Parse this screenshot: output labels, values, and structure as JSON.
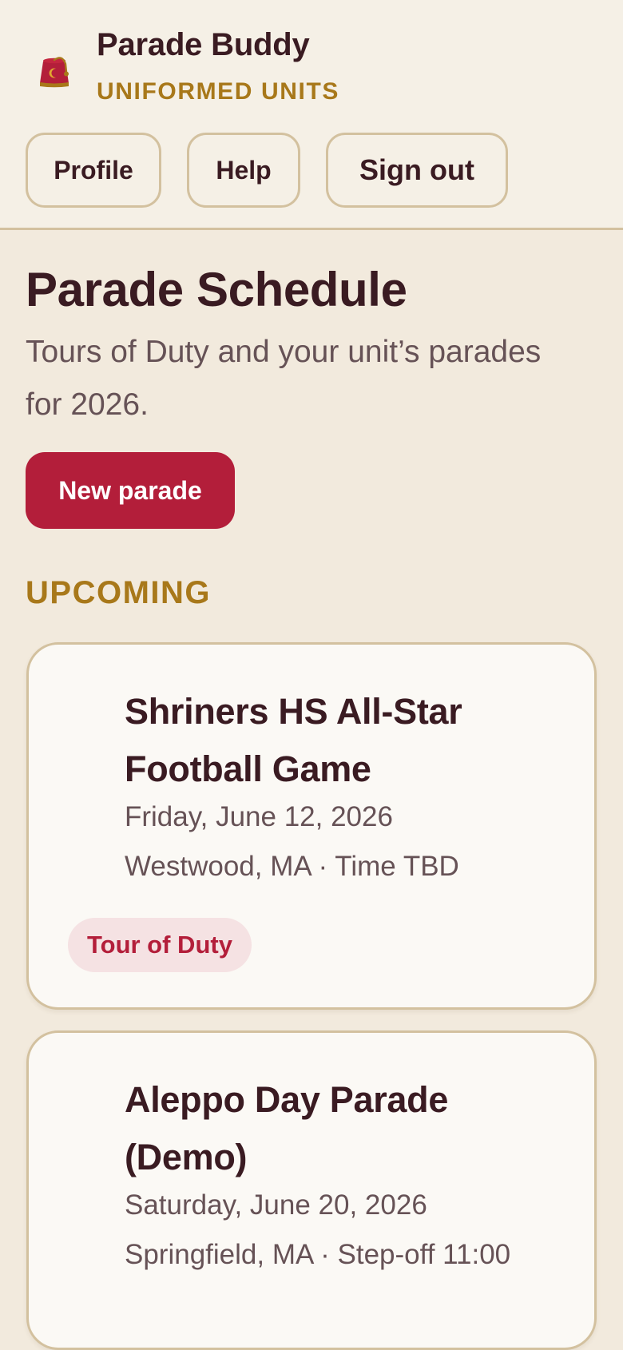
{
  "app": {
    "name": "Parade Buddy",
    "subtitle": "UNIFORMED UNITS",
    "logo_icon": "fez-icon"
  },
  "nav": {
    "profile": "Profile",
    "help": "Help",
    "sign_out": "Sign out"
  },
  "page": {
    "title": "Parade Schedule",
    "description": "Tours of Duty and your unit’s parades for 2026.",
    "new_parade_label": "New parade",
    "section_upcoming": "UPCOMING"
  },
  "parades": [
    {
      "title": "Shriners HS All-Star Football Game",
      "date": "Friday, June 12, 2026",
      "location": "Westwood, MA · Time TBD",
      "badge": "Tour of Duty"
    },
    {
      "title": "Aleppo Day Parade (Demo)",
      "date": "Saturday, June 20, 2026",
      "location": "Springfield, MA · Step-off 11:00"
    }
  ],
  "colors": {
    "accent": "#b31e3a",
    "gold": "#a8781a",
    "text": "#3a1b22",
    "muted": "#665256",
    "border": "#d3c19f",
    "background": "#f2eadd",
    "header_background": "#f5f0e6",
    "card_background": "#fbf9f5",
    "badge_background": "#f5e2e3"
  }
}
